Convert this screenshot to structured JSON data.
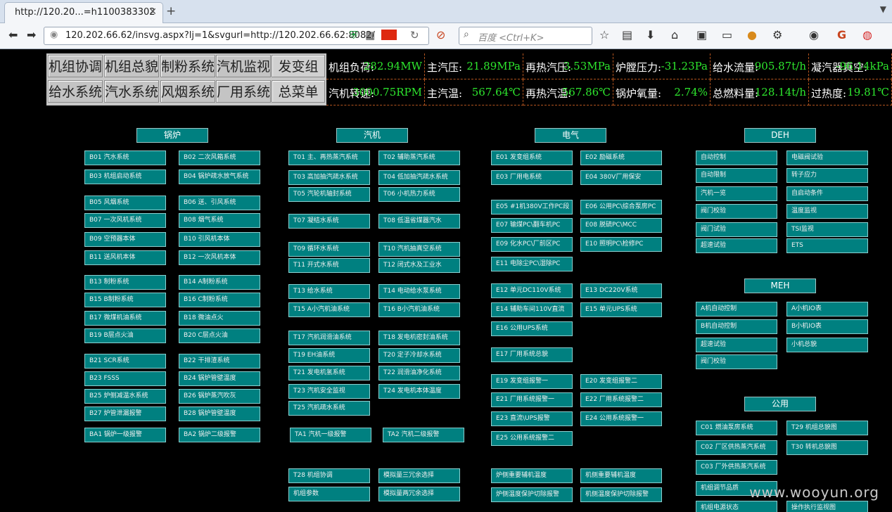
{
  "browser": {
    "tab_title": "http://120.20...=h1100383302",
    "url": "120.202.66.62/insvg.aspx?lj=1&svgurl=http://120.202.66.62:8082/",
    "search_placeholder": "百度 <Ctrl+K>"
  },
  "menu": {
    "row1": [
      "机组协调",
      "机组总貌",
      "制粉系统",
      "汽机监视",
      "发变组"
    ],
    "row2": [
      "给水系统",
      "汽水系统",
      "风烟系统",
      "厂用系统",
      "总菜单"
    ]
  },
  "params": {
    "row1": [
      {
        "label": "机组负荷:",
        "value": "282.94MW"
      },
      {
        "label": "主汽压:",
        "value": "21.89MPa"
      },
      {
        "label": "再热汽压:",
        "value": "3.53MPa"
      },
      {
        "label": "炉膛压力:",
        "value": "-31.23Pa"
      },
      {
        "label": "给水流量:",
        "value": "905.87t/h"
      },
      {
        "label": "凝汽器真空:",
        "value": "-96.14kPa"
      }
    ],
    "row2": [
      {
        "label": "汽机转速:",
        "value": "3000.75RPM"
      },
      {
        "label": "主汽温:",
        "value": "567.64℃"
      },
      {
        "label": "再热汽温:",
        "value": "567.86℃"
      },
      {
        "label": "锅炉氧量:",
        "value": "2.74%"
      },
      {
        "label": "总燃料量:",
        "value": "128.14t/h"
      },
      {
        "label": "过热度:",
        "value": "19.81℃"
      }
    ]
  },
  "sections": {
    "boiler": "锅炉",
    "turbine": "汽机",
    "electrical": "电气",
    "deh": "DEH",
    "meh": "MEH",
    "common": "公用"
  },
  "boiler": [
    "B01  汽水系统",
    "B02  二次风箱系统",
    "B03  机组启动系统",
    "B04  锅炉疏水放气系统",
    "B05  风烟系统",
    "B06  送、引风系统",
    "B07  一次风机系统",
    "B08  烟气系统",
    "B09  空预器本体",
    "B10  引风机本体",
    "B11  送风机本体",
    "B12  一次风机本体",
    "B13  制粉系统",
    "B14  A制粉系统",
    "B15  B制粉系统",
    "B16  C制粉系统",
    "B17  微煤机油系统",
    "B18  微油点火",
    "B19  B层点火油",
    "B20  C层点火油",
    "B21  SCR系统",
    "B22  干排渣系统",
    "B23  FSSS",
    "B24  锅炉管壁温度",
    "B25  炉侧减温水系统",
    "B26  锅炉蒸汽吹灰",
    "B27  炉管泄漏报警",
    "B28  锅炉管壁温度",
    "BA1  锅炉一级报警",
    "BA2  锅炉二级报警"
  ],
  "turbine": [
    "T01  主、再热蒸汽系统",
    "T02  辅助蒸汽系统",
    "T03  高加抽汽疏水系统",
    "T04  低加抽汽疏水系统",
    "T05  汽轮机轴封系统",
    "T06  小机热力系统",
    "T07  凝结水系统",
    "T08  低温省煤器汽水",
    "T09  循环水系统",
    "T10  汽机抽真空系统",
    "T11  开式水系统",
    "T12  闭式水及工业水",
    "T13  给水系统",
    "T14  电动给水泵系统",
    "T15  A小汽机油系统",
    "T16  B小汽机油系统",
    "T17  汽机润滑油系统",
    "T18  发电机密封油系统",
    "T19  EH油系统",
    "T20  定子冷却水系统",
    "T21  发电机氢系统",
    "T22  润滑油净化系统",
    "T23  汽机安全监视",
    "T24  发电机本体温度",
    "T25  汽机疏水系统",
    "TA1  汽机一级报警",
    "TA2  汽机二级报警",
    "T28  机组协调",
    "模拟量三冗余选择",
    "机组参数",
    "模拟量两冗余选择"
  ],
  "electrical": [
    "E01  发变组系统",
    "E02  励磁系统",
    "E03  厂用电系统",
    "E04  380V厂用保安",
    "E05  #1机380V工作PC段",
    "E06  公用PC\\综合泵房PC",
    "E07  输煤PC\\翻车机PC",
    "E08  脱硫PC\\MCC",
    "E09  化水PC\\厂前区PC",
    "E10  照明PC\\检修PC",
    "E11  电除尘PC\\湿除PC",
    "E12  单元DC110V系统",
    "E13  DC220V系统",
    "E14  辅助车间110V直流",
    "E15  单元UPS系统",
    "E16  公用UPS系统",
    "E17  厂用系统总貌",
    "E19  发变组报警一",
    "E20  发变组报警二",
    "E21  厂用系统报警一",
    "E22  厂用系统报警二",
    "E23  直流\\UPS报警",
    "E24  公用系统报警一",
    "E25  公用系统报警二",
    "炉侧重要辅机温度",
    "机侧重要辅机温度",
    "炉侧温度保护切除报警",
    "机侧温度保护切除报警"
  ],
  "deh": [
    "自动控制",
    "电磁阀试验",
    "自动限制",
    "转子应力",
    "汽机一览",
    "自启动条件",
    "阀门校验",
    "温度监视",
    "阀门试验",
    "TSI监视",
    "超速试验",
    "ETS"
  ],
  "meh": [
    "A机自动控制",
    "A小机IO表",
    "B机自动控制",
    "B小机IO表",
    "超速试验",
    "小机总貌",
    "阀门校验"
  ],
  "common": [
    "C01  燃油泵房系统",
    "T29  机组总貌图",
    "C02  厂区供热蒸汽系统",
    "T30  转机总貌图",
    "C03  厂外供热蒸汽系统",
    "机组调节品质",
    "机组电源状态",
    "操作执行监视图"
  ],
  "watermark": "www.wooyun.org"
}
